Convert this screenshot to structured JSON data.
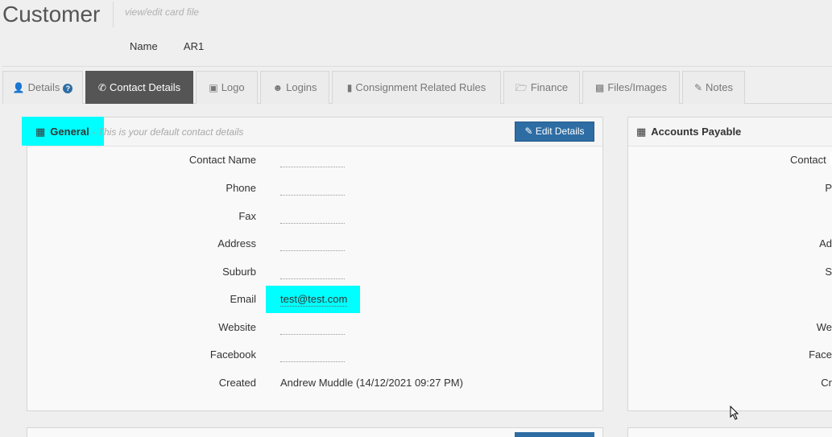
{
  "header": {
    "title": "Customer",
    "subtitle": "view/edit card file",
    "name_label": "Name",
    "name_value": "AR1"
  },
  "tabs": [
    {
      "label": "Details",
      "icon": "user-icon"
    },
    {
      "label": "Contact Details",
      "icon": "phone-icon",
      "active": true
    },
    {
      "label": "Logo",
      "icon": "image-icon"
    },
    {
      "label": "Logins",
      "icon": "users-icon"
    },
    {
      "label": "Consignment Related Rules",
      "icon": "file-icon"
    },
    {
      "label": "Finance",
      "icon": "folder-open-icon"
    },
    {
      "label": "Files/Images",
      "icon": "file-image-icon"
    },
    {
      "label": "Notes",
      "icon": "pencil-icon"
    }
  ],
  "help_glyph": "?",
  "general": {
    "title": "General",
    "description": "- This is your default contact details",
    "edit_button": "Edit Details",
    "fields": {
      "contact_name": {
        "label": "Contact Name",
        "value": ""
      },
      "phone": {
        "label": "Phone",
        "value": ""
      },
      "fax": {
        "label": "Fax",
        "value": ""
      },
      "address": {
        "label": "Address",
        "value": ""
      },
      "suburb": {
        "label": "Suburb",
        "value": ""
      },
      "email": {
        "label": "Email",
        "value": "test@test.com"
      },
      "website": {
        "label": "Website",
        "value": ""
      },
      "facebook": {
        "label": "Facebook",
        "value": ""
      },
      "created": {
        "label": "Created",
        "value": "Andrew Muddle (14/12/2021 09:27 PM)"
      }
    }
  },
  "accounts_payable": {
    "title": "Accounts Payable",
    "labels_partial": [
      "Contact I",
      "P",
      "Ad",
      "S",
      "We",
      "Face",
      "Cr"
    ]
  },
  "colors": {
    "accent": "#2e6da4",
    "active_tab": "#555555",
    "highlight": "#00ffff"
  }
}
